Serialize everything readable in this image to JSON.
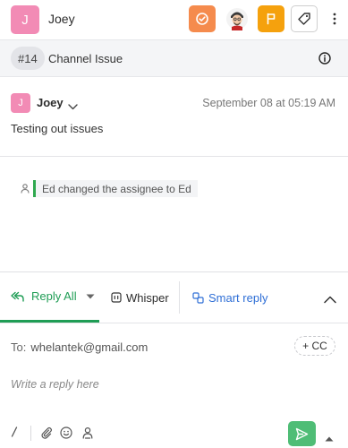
{
  "header": {
    "avatar_initial": "J",
    "contact_name": "Joey",
    "avatar_color": "#f28bb5"
  },
  "channel": {
    "number": "#14",
    "title": "Channel Issue"
  },
  "message": {
    "avatar_initial": "J",
    "author": "Joey",
    "timestamp": "September 08 at 05:19 AM",
    "body": "Testing out issues"
  },
  "activity": {
    "text": "Ed changed the assignee to Ed"
  },
  "composer": {
    "tabs": {
      "reply_all": "Reply All",
      "whisper": "Whisper",
      "smart_reply": "Smart reply"
    },
    "to_label": "To:",
    "to_email": "whelantek@gmail.com",
    "cc_label": "+ CC",
    "reply_placeholder": "Write a reply here"
  },
  "colors": {
    "status_button": "#f58b4d",
    "flag_button": "#f5a10d",
    "reply_accent": "#1f9d55",
    "smart_reply_accent": "#2f6fd6",
    "send_button": "#4fbd76"
  },
  "icons": {
    "status": "check-circle-icon",
    "agent": "agent-avatar-icon",
    "flag": "flag-icon",
    "tag": "tag-icon",
    "more": "more-vertical-icon",
    "info": "info-icon",
    "reply": "reply-all-icon",
    "whisper": "whisper-icon",
    "smart_reply": "smart-reply-icon",
    "collapse": "chevron-up-icon",
    "slash": "slash-command-icon",
    "attach": "paperclip-icon",
    "emoji": "smiley-icon",
    "mention": "person-mention-icon",
    "send": "send-icon"
  }
}
